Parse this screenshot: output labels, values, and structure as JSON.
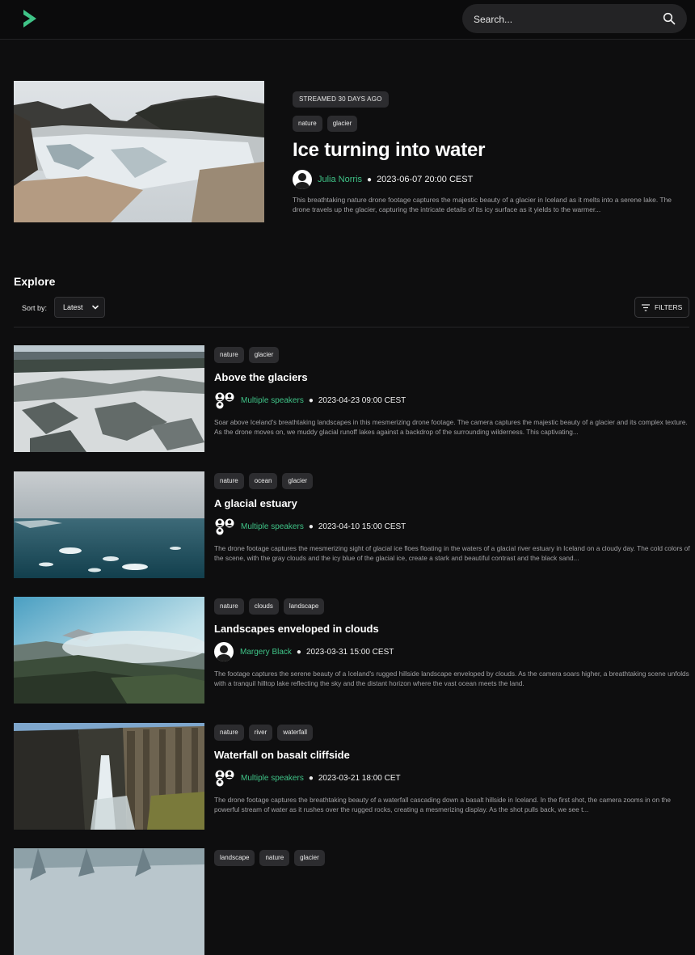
{
  "header": {
    "search_placeholder": "Search...",
    "brand_color": "#3fc387"
  },
  "hero": {
    "badge": "STREAMED 30 DAYS AGO",
    "tags": [
      "nature",
      "glacier"
    ],
    "title": "Ice turning into water",
    "speaker": "Julia Norris",
    "date": "2023-06-07 20:00 CEST",
    "description": "This breathtaking nature drone footage captures the majestic beauty of a glacier in Iceland as it melts into a serene lake. The drone travels up the glacier, capturing the intricate details of its icy surface as it yields to the warmer..."
  },
  "explore": {
    "title": "Explore",
    "sort_label": "Sort by:",
    "sort_value": "Latest",
    "filters_label": "FILTERS"
  },
  "items": [
    {
      "tags": [
        "nature",
        "glacier"
      ],
      "title": "Above the glaciers",
      "speaker": "Multiple speakers",
      "multi": true,
      "date": "2023-04-23 09:00 CEST",
      "description": "Soar above Iceland's breathtaking landscapes in this mesmerizing drone footage. The camera captures the majestic beauty of a glacier and its complex texture. As the drone moves on, we muddy glacial runoff lakes against a backdrop of the surrounding wilderness. This captivating..."
    },
    {
      "tags": [
        "nature",
        "ocean",
        "glacier"
      ],
      "title": "A glacial estuary",
      "speaker": "Multiple speakers",
      "multi": true,
      "date": "2023-04-10 15:00 CEST",
      "description": "The drone footage captures the mesmerizing sight of glacial ice floes floating in the waters of a glacial river estuary in Iceland on a cloudy day. The cold colors of the scene, with the gray clouds and the icy blue of the glacial ice, create a stark and beautiful contrast and the black sand..."
    },
    {
      "tags": [
        "nature",
        "clouds",
        "landscape"
      ],
      "title": "Landscapes enveloped in clouds",
      "speaker": "Margery Black",
      "multi": false,
      "date": "2023-03-31 15:00 CEST",
      "description": "The footage captures the serene beauty of a Iceland's rugged hillside landscape enveloped by clouds. As the camera soars higher, a breathtaking scene unfolds with a tranquil hilltop lake reflecting the sky and the distant horizon where the vast ocean meets the land."
    },
    {
      "tags": [
        "nature",
        "river",
        "waterfall"
      ],
      "title": "Waterfall on basalt cliffside",
      "speaker": "Multiple speakers",
      "multi": true,
      "date": "2023-03-21 18:00 CET",
      "description": "The drone footage captures the breathtaking beauty of a waterfall cascading down a basalt hillside in Iceland. In the first shot, the camera zooms in on the powerful stream of water as it rushes over the rugged rocks, creating a mesmerizing display. As the shot pulls back, we see t..."
    },
    {
      "tags": [
        "landscape",
        "nature",
        "glacier"
      ]
    }
  ]
}
